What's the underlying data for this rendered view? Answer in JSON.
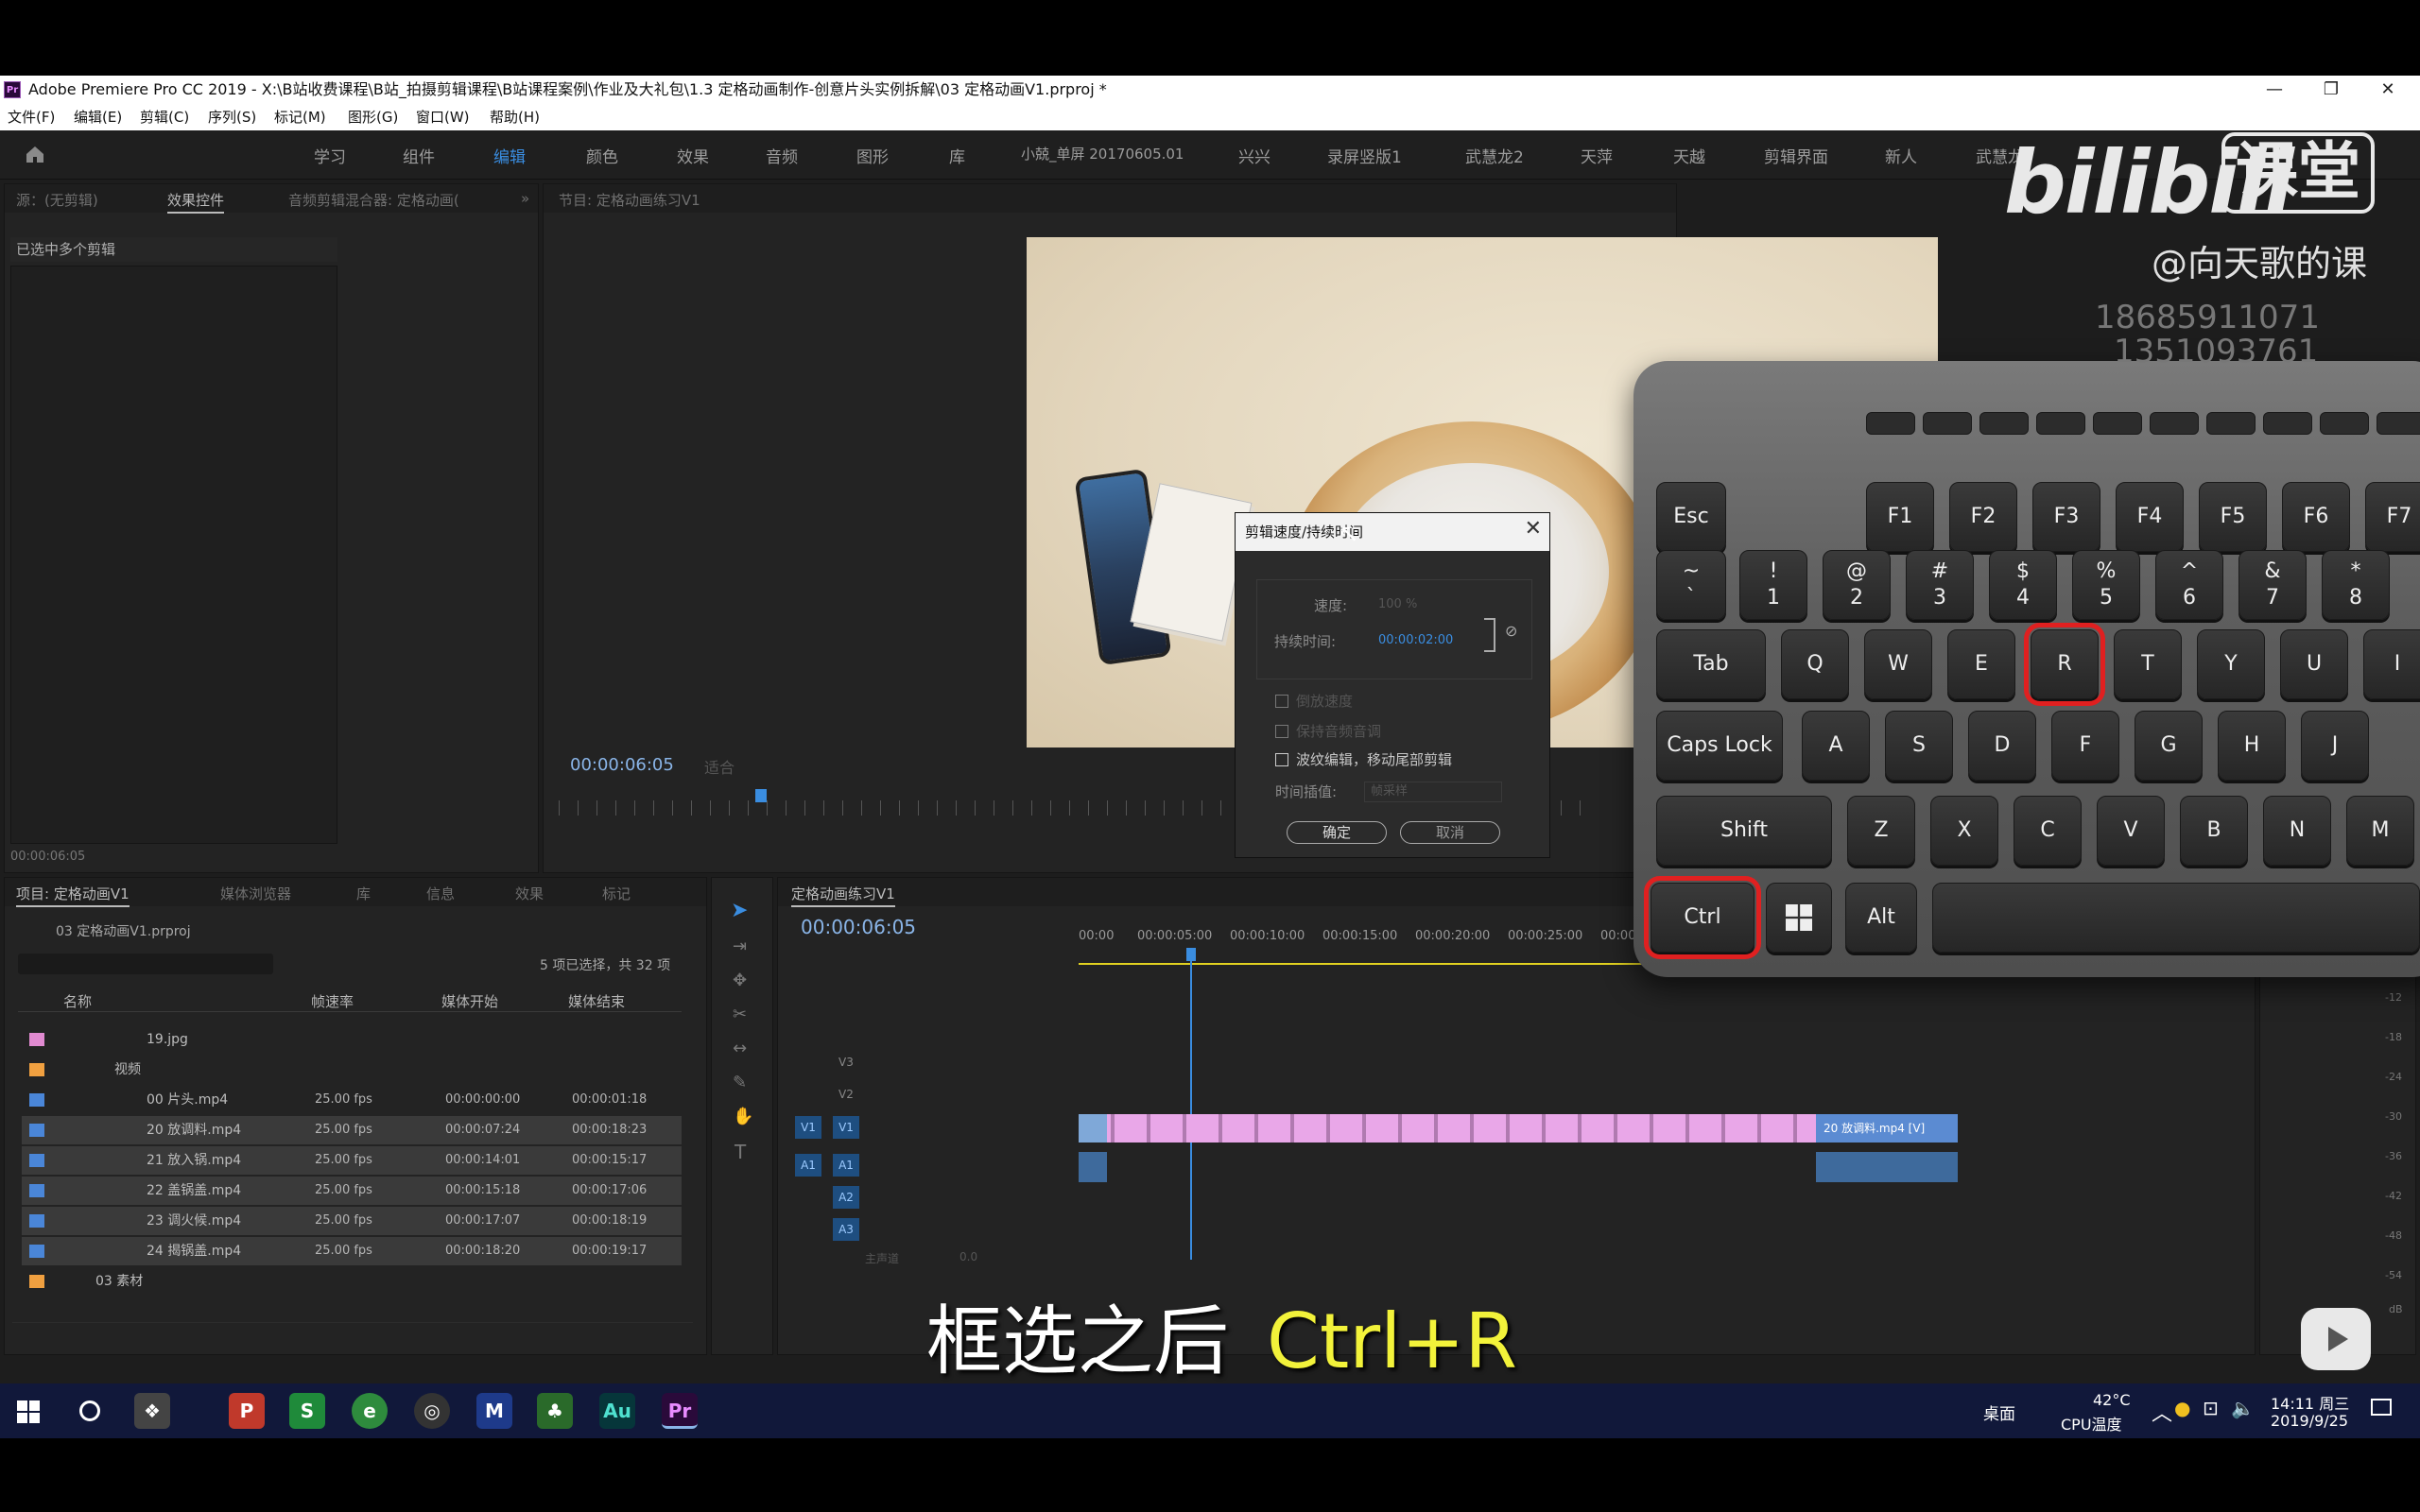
{
  "window": {
    "app_logo": "Pr",
    "title": "Adobe Premiere Pro CC 2019 - X:\\B站收费课程\\B站_拍摄剪辑课程\\B站课程案例\\作业及大礼包\\1.3 定格动画制作-创意片头实例拆解\\03 定格动画V1.prproj *",
    "minimize": "—",
    "restore": "❐",
    "close": "✕"
  },
  "menu": [
    "文件(F)",
    "编辑(E)",
    "剪辑(C)",
    "序列(S)",
    "标记(M)",
    "图形(G)",
    "窗口(W)",
    "帮助(H)"
  ],
  "workspaces": [
    "学习",
    "组件",
    "编辑",
    "颜色",
    "效果",
    "音频",
    "图形",
    "库",
    "小兢_单屏 20170605.01",
    "兴兴",
    "录屏竖版1",
    "武慧龙2",
    "天萍",
    "天越",
    "剪辑界面",
    "新人",
    "武慧龙"
  ],
  "active_workspace": "编辑",
  "source_panel": {
    "tabs": [
      "源：(无剪辑)",
      "效果控件",
      "音频剪辑混合器: 定格动画("
    ],
    "header": "已选中多个剪辑",
    "timecode": "00:00:06:05"
  },
  "program_panel": {
    "tab": "节目: 定格动画练习V1",
    "timecode": "00:00:06:05",
    "fit": "适合"
  },
  "dialog": {
    "title": "剪辑速度/持续时间",
    "speed_label": "速度:",
    "speed_value": "100 %",
    "duration_label": "持续时间:",
    "duration_value": "00:00:02:00",
    "reverse": "倒放速度",
    "keep_pitch": "保持音频音调",
    "ripple": "波纹编辑，移动尾部剪辑",
    "interp_label": "时间插值:",
    "interp_value": "帧采样",
    "ok": "确定",
    "cancel": "取消"
  },
  "project_panel": {
    "tabs": [
      "项目: 定格动画V1",
      "媒体浏览器",
      "库",
      "信息",
      "效果",
      "标记"
    ],
    "file": "03 定格动画V1.prproj",
    "selection": "5 项已选择，共 32 项",
    "columns": [
      "名称",
      "帧速率",
      "媒体开始",
      "媒体结束"
    ],
    "rows": [
      {
        "name": "19.jpg",
        "fps": "",
        "start": "",
        "end": "",
        "color": "#e08ad0"
      },
      {
        "name": "视频",
        "fps": "",
        "start": "",
        "end": "",
        "color": "#f0a040"
      },
      {
        "name": "00 片头.mp4",
        "fps": "25.00 fps",
        "start": "00:00:00:00",
        "end": "00:00:01:18",
        "color": "#4a86d8"
      },
      {
        "name": "20 放调料.mp4",
        "fps": "25.00 fps",
        "start": "00:00:07:24",
        "end": "00:00:18:23",
        "color": "#4a86d8"
      },
      {
        "name": "21 放入锅.mp4",
        "fps": "25.00 fps",
        "start": "00:00:14:01",
        "end": "00:00:15:17",
        "color": "#4a86d8"
      },
      {
        "name": "22 盖锅盖.mp4",
        "fps": "25.00 fps",
        "start": "00:00:15:18",
        "end": "00:00:17:06",
        "color": "#4a86d8"
      },
      {
        "name": "23 调火候.mp4",
        "fps": "25.00 fps",
        "start": "00:00:17:07",
        "end": "00:00:18:19",
        "color": "#4a86d8"
      },
      {
        "name": "24 揭锅盖.mp4",
        "fps": "25.00 fps",
        "start": "00:00:18:20",
        "end": "00:00:19:17",
        "color": "#4a86d8"
      },
      {
        "name": "03 素材",
        "fps": "",
        "start": "",
        "end": "",
        "color": "#f0a040"
      }
    ]
  },
  "timeline": {
    "tab": "定格动画练习V1",
    "timecode": "00:00:06:05",
    "ruler": [
      "00:00",
      "00:00:05:00",
      "00:00:10:00",
      "00:00:15:00",
      "00:00:20:00",
      "00:00:25:00",
      "00:00"
    ],
    "tracks": [
      "V3",
      "V2",
      "V1",
      "A1",
      "A2",
      "A3"
    ],
    "master": "主声道",
    "master_val": "0.0",
    "clip_label": "20 放调料.mp4 [V]"
  },
  "audio_meter": [
    "-12",
    "-18",
    "-24",
    "-30",
    "-36",
    "-42",
    "-48",
    "-54",
    "dB"
  ],
  "keyboard": {
    "esc": "Esc",
    "fkeys": [
      "F1",
      "F2",
      "F3",
      "F4",
      "F5",
      "F6",
      "F7"
    ],
    "row1": [
      [
        "~",
        "`"
      ],
      [
        "!",
        "1"
      ],
      [
        "@",
        "2"
      ],
      [
        "#",
        "3"
      ],
      [
        "$",
        "4"
      ],
      [
        "%",
        "5"
      ],
      [
        "^",
        "6"
      ],
      [
        "&",
        "7"
      ],
      [
        "*",
        "8"
      ]
    ],
    "row2": [
      "Tab",
      "Q",
      "W",
      "E",
      "R",
      "T",
      "Y",
      "U",
      "I"
    ],
    "row3": [
      "Caps Lock",
      "A",
      "S",
      "D",
      "F",
      "G",
      "H",
      "J"
    ],
    "row4": [
      "Shift",
      "Z",
      "X",
      "C",
      "V",
      "B",
      "N",
      "M"
    ],
    "row5": [
      "Ctrl",
      "Alt"
    ],
    "highlight_color": "#e02020"
  },
  "watermark": {
    "brand": "bilibili",
    "brand_cn": "课堂",
    "author": "@向天歌的课",
    "phone1": "18685911071",
    "phone2": "1351093761"
  },
  "subtitle": {
    "text": "框选之后",
    "shortcut": "Ctrl+R"
  },
  "taskbar": {
    "desktop": "桌面",
    "temp": "42°C",
    "temp_label": "CPU温度",
    "time": "14:11 周三",
    "date": "2019/9/25",
    "apps": [
      "P",
      "S",
      "e",
      "◎",
      "M",
      "♣",
      "Au",
      "Pr"
    ]
  },
  "colors": {
    "accent_blue": "#3a8de0",
    "clip_pink": "#e9a7e8",
    "subtitle_yellow": "#f2f23a"
  }
}
